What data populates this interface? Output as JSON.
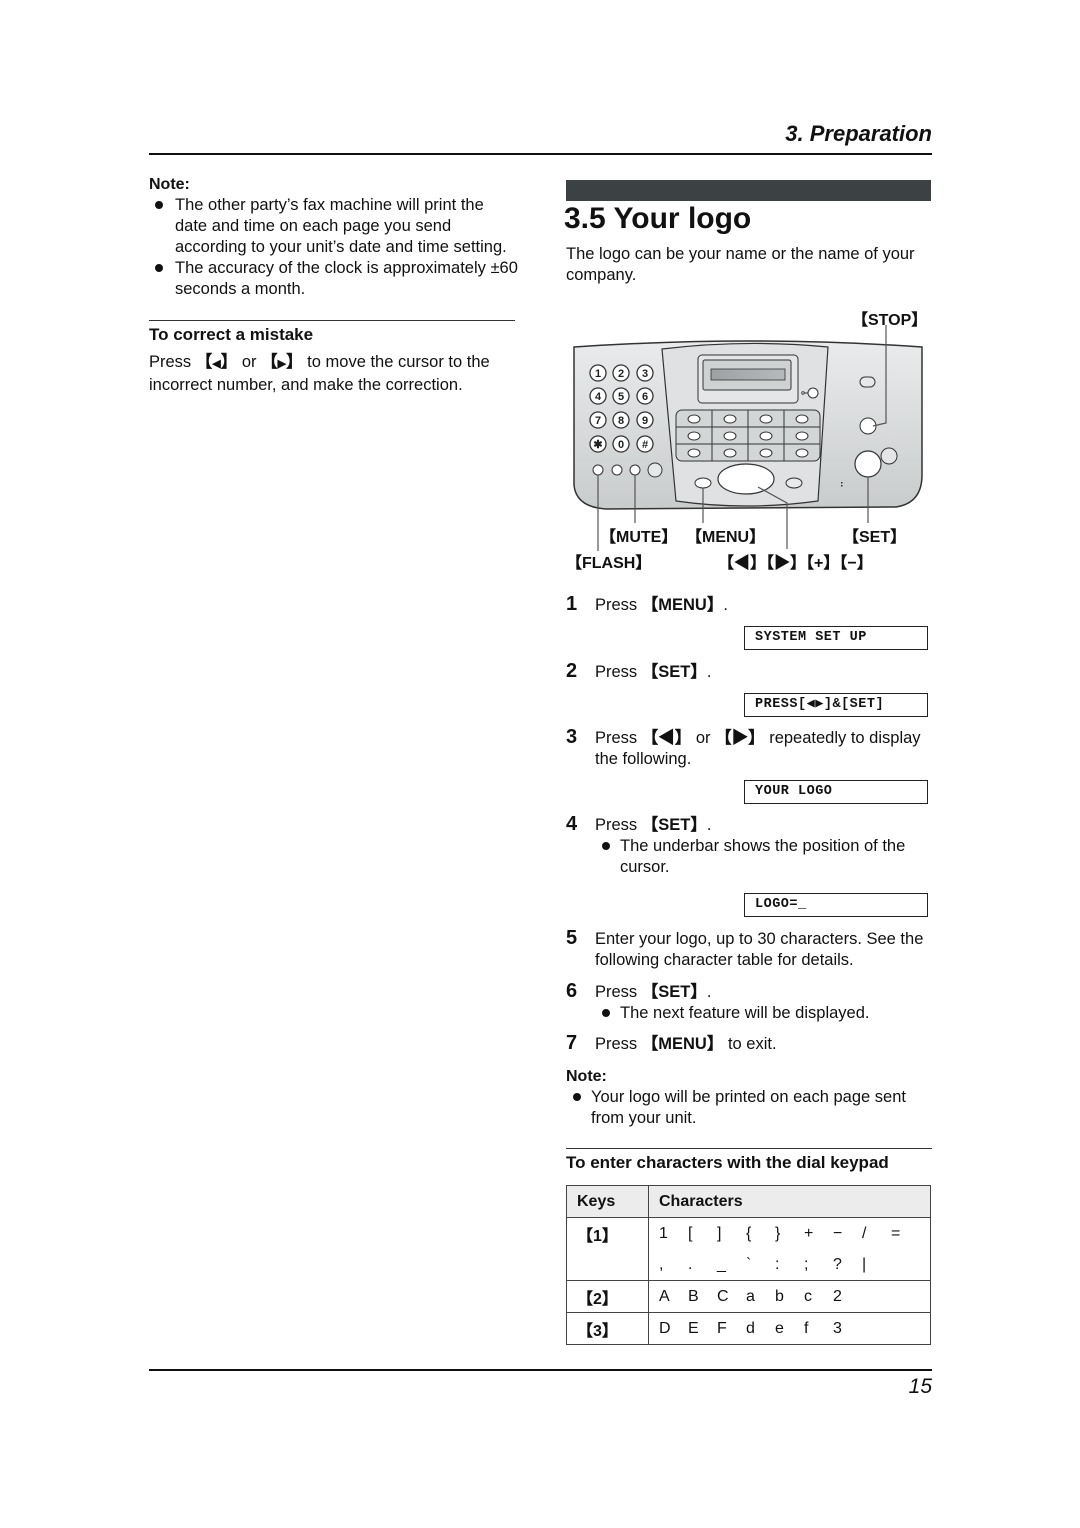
{
  "header": {
    "chapter": "3. Preparation"
  },
  "left": {
    "note_label": "Note:",
    "notes": [
      "The other party’s fax machine will print the date and time on each page you send according to your unit’s date and time setting.",
      "The accuracy of the clock is approximately ±60 seconds a month."
    ],
    "correct_heading": "To correct a mistake",
    "correct_text_pre": "Press",
    "correct_key_left": "◀",
    "correct_or": "or",
    "correct_key_right": "▶",
    "correct_text_post": "to move the cursor to the incorrect number, and make the correction."
  },
  "section": {
    "title": "3.5 Your logo",
    "intro": "The logo can be your name or the name of your company."
  },
  "device": {
    "labels": {
      "stop": "【STOP】",
      "mute": "【MUTE】",
      "menu": "【MENU】",
      "set": "【SET】",
      "flash": "【FLASH】",
      "nav": "【◀】【▶】【+】【−】"
    },
    "keypad": [
      "1",
      "2",
      "3",
      "4",
      "5",
      "6",
      "7",
      "8",
      "9",
      "✱",
      "0",
      "#"
    ]
  },
  "steps": [
    {
      "num": "1",
      "pre": "Press ",
      "key": "【MENU】",
      "post": ".",
      "display": "SYSTEM SET UP"
    },
    {
      "num": "2",
      "pre": "Press ",
      "key": "【SET】",
      "post": ".",
      "display": "PRESS[◀▶]&[SET]"
    },
    {
      "num": "3",
      "pre": "Press ",
      "key": "【◀】",
      "mid": " or ",
      "key2": "【▶】",
      "post": " repeatedly to display the following.",
      "display": "YOUR LOGO"
    },
    {
      "num": "4",
      "pre": "Press ",
      "key": "【SET】",
      "post": ".",
      "bullet": "The underbar shows the position of the cursor.",
      "display": "LOGO=_"
    },
    {
      "num": "5",
      "text": "Enter your logo, up to 30 characters. See the following character table for details."
    },
    {
      "num": "6",
      "pre": "Press ",
      "key": "【SET】",
      "post": ".",
      "bullet": "The next feature will be displayed."
    },
    {
      "num": "7",
      "pre": "Press ",
      "key": "【MENU】",
      "post": " to exit."
    }
  ],
  "right_note": {
    "label": "Note:",
    "text": "Your logo will be printed on each page sent from your unit."
  },
  "table": {
    "heading": "To enter characters with the dial keypad",
    "col_keys": "Keys",
    "col_chars": "Characters",
    "rows": [
      {
        "key": "【1】",
        "lines": [
          [
            "1",
            "[",
            "]",
            "{",
            "}",
            "+",
            "−",
            "/",
            "="
          ],
          [
            ",",
            ".",
            "_",
            "`",
            ":",
            ";",
            "?",
            "|"
          ]
        ]
      },
      {
        "key": "【2】",
        "lines": [
          [
            "A",
            "B",
            "C",
            "a",
            "b",
            "c",
            "2"
          ]
        ]
      },
      {
        "key": "【3】",
        "lines": [
          [
            "D",
            "E",
            "F",
            "d",
            "e",
            "f",
            "3"
          ]
        ]
      }
    ]
  },
  "footer": {
    "page_number": "15"
  }
}
